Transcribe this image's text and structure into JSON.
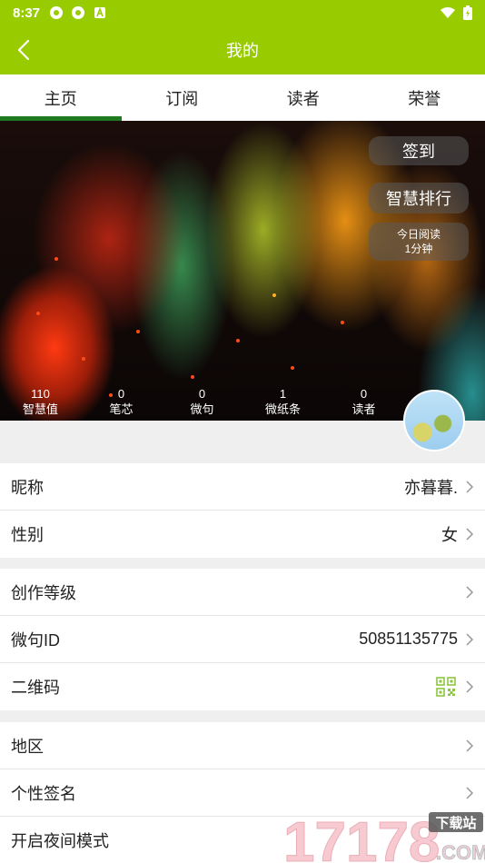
{
  "status_bar": {
    "time": "8:37"
  },
  "navbar": {
    "title": "我的"
  },
  "tabs": [
    {
      "label": "主页",
      "active": true
    },
    {
      "label": "订阅",
      "active": false
    },
    {
      "label": "读者",
      "active": false
    },
    {
      "label": "荣誉",
      "active": false
    }
  ],
  "hero": {
    "sign_in": "签到",
    "wisdom_rank": "智慧排行",
    "today_reading_label": "今日阅读",
    "today_reading_value": "1分钟",
    "stats": [
      {
        "value": "110",
        "label": "智慧值"
      },
      {
        "value": "0",
        "label": "笔芯"
      },
      {
        "value": "0",
        "label": "微句"
      },
      {
        "value": "1",
        "label": "微纸条"
      },
      {
        "value": "0",
        "label": "读者"
      }
    ]
  },
  "profile": {
    "nickname_label": "昵称",
    "nickname_value": "亦暮暮.",
    "gender_label": "性别",
    "gender_value": "女",
    "level_label": "创作等级",
    "weiju_id_label": "微句ID",
    "weiju_id_value": "50851135775",
    "qrcode_label": "二维码",
    "region_label": "地区",
    "signature_label": "个性签名",
    "night_mode_label": "开启夜间模式"
  },
  "watermark": {
    "number": "17178",
    "top": "下载站",
    "com": ".COM"
  },
  "colors": {
    "brand_green": "#99cc00",
    "tab_indicator": "#1e7a1e",
    "qr_green": "#8cc63f"
  }
}
